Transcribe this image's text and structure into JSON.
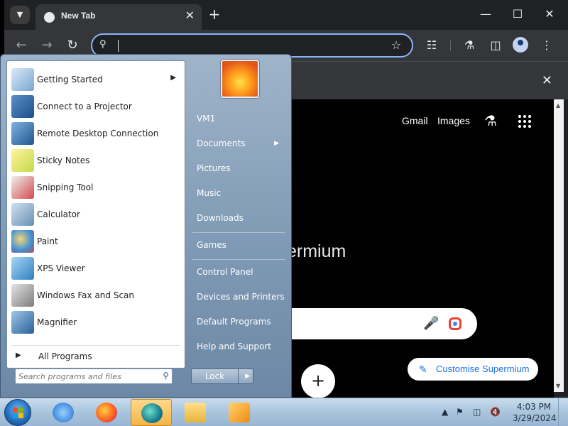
{
  "browser": {
    "tab": {
      "title": "New Tab"
    },
    "omnibox": {
      "value": "",
      "placeholder": ""
    },
    "page": {
      "links": [
        "Gmail",
        "Images"
      ],
      "brand_fragment": "ermium",
      "customise_label": "Customise Supermium"
    }
  },
  "start_menu": {
    "programs": [
      {
        "label": "Getting Started",
        "icon": "getting-started-icon",
        "has_submenu": true
      },
      {
        "label": "Connect to a Projector",
        "icon": "projector-icon"
      },
      {
        "label": "Remote Desktop Connection",
        "icon": "remote-desktop-icon"
      },
      {
        "label": "Sticky Notes",
        "icon": "sticky-notes-icon"
      },
      {
        "label": "Snipping Tool",
        "icon": "snipping-tool-icon"
      },
      {
        "label": "Calculator",
        "icon": "calculator-icon"
      },
      {
        "label": "Paint",
        "icon": "paint-icon"
      },
      {
        "label": "XPS Viewer",
        "icon": "xps-viewer-icon"
      },
      {
        "label": "Windows Fax and Scan",
        "icon": "fax-scan-icon"
      },
      {
        "label": "Magnifier",
        "icon": "magnifier-icon"
      }
    ],
    "all_programs_label": "All Programs",
    "search_placeholder": "Search programs and files",
    "right_links": [
      {
        "label": "VM1"
      },
      {
        "label": "Documents",
        "has_submenu": true
      },
      {
        "label": "Pictures"
      },
      {
        "label": "Music"
      },
      {
        "label": "Downloads"
      },
      {
        "label": "Games"
      },
      {
        "label": "Control Panel"
      },
      {
        "label": "Devices and Printers"
      },
      {
        "label": "Default Programs"
      },
      {
        "label": "Help and Support"
      }
    ],
    "lock_label": "Lock"
  },
  "taskbar": {
    "apps": [
      "internet-explorer-icon",
      "firefox-icon",
      "edge-icon",
      "file-explorer-icon",
      "media-player-icon"
    ],
    "clock": {
      "time": "4:03 PM",
      "date": "3/29/2024"
    }
  }
}
